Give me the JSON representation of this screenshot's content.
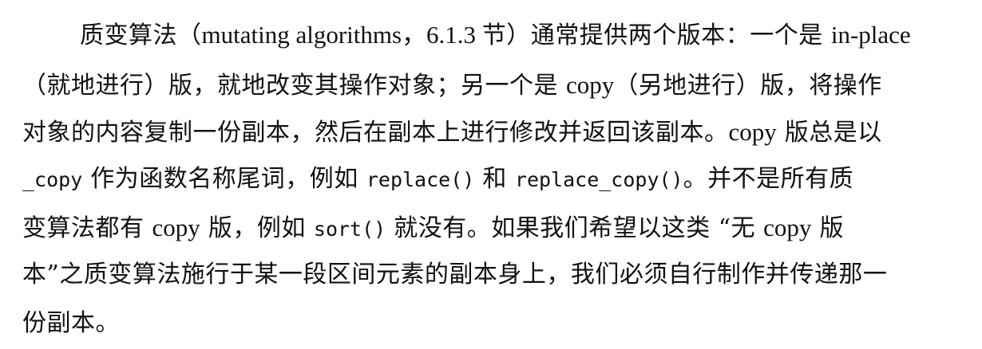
{
  "paragraph": {
    "lines": [
      {
        "segments": [
          {
            "t": "质变算法（",
            "k": "cjk"
          },
          {
            "t": "mutating algorithms，6.1.3 ",
            "k": "latin"
          },
          {
            "t": "节）通常提供两个版本：一个是 ",
            "k": "cjk"
          },
          {
            "t": "in-place",
            "k": "latin"
          }
        ]
      },
      {
        "segments": [
          {
            "t": "（就地进行）版，就地改变其操作对象；另一个是 ",
            "k": "cjk"
          },
          {
            "t": "copy",
            "k": "latin"
          },
          {
            "t": "（另地进行）版，将操作",
            "k": "cjk"
          }
        ]
      },
      {
        "segments": [
          {
            "t": "对象的内容复制一份副本，然后在副本上进行修改并返回该副本。",
            "k": "cjk"
          },
          {
            "t": "copy",
            "k": "latin"
          },
          {
            "t": " 版总是以",
            "k": "cjk"
          }
        ]
      },
      {
        "segments": [
          {
            "t": "_copy",
            "k": "code"
          },
          {
            "t": " 作为函数名称尾词，例如 ",
            "k": "cjk"
          },
          {
            "t": "replace()",
            "k": "code"
          },
          {
            "t": " 和 ",
            "k": "cjk"
          },
          {
            "t": "replace_copy()",
            "k": "code"
          },
          {
            "t": "。并不是所有质",
            "k": "cjk"
          }
        ]
      },
      {
        "segments": [
          {
            "t": "变算法都有 ",
            "k": "cjk"
          },
          {
            "t": "copy",
            "k": "latin"
          },
          {
            "t": " 版，例如 ",
            "k": "cjk"
          },
          {
            "t": "sort()",
            "k": "code"
          },
          {
            "t": " 就没有。如果我们希望以这类 “无 ",
            "k": "cjk"
          },
          {
            "t": "copy",
            "k": "latin"
          },
          {
            "t": " 版",
            "k": "cjk"
          }
        ]
      },
      {
        "segments": [
          {
            "t": "本”之质变算法施行于某一段区间元素的副本身上，我们必须自行制作并传递那一",
            "k": "cjk"
          }
        ]
      },
      {
        "segments": [
          {
            "t": "份副本。",
            "k": "cjk"
          }
        ]
      }
    ]
  }
}
